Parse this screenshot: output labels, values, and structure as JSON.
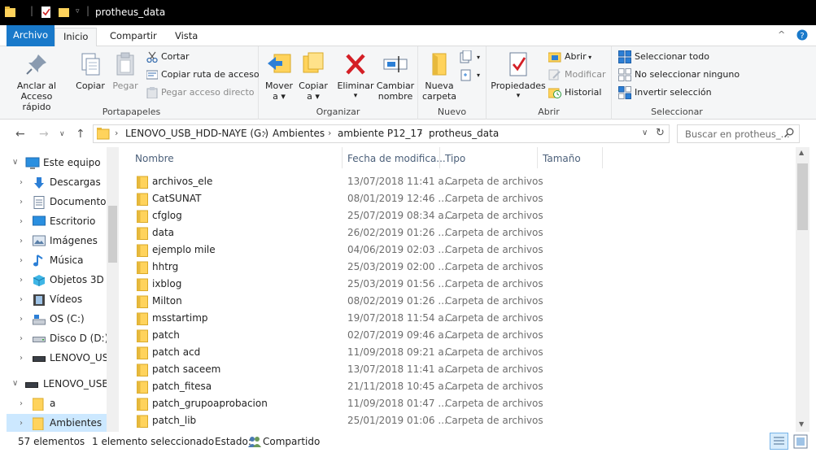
{
  "window": {
    "title": "protheus_data"
  },
  "ribbon_tabs": [
    "Archivo",
    "Inicio",
    "Compartir",
    "Vista"
  ],
  "ribbon": {
    "portapapeles": {
      "label": "Portapapeles",
      "anclar_line1": "Anclar al",
      "anclar_line2": "Acceso rápido",
      "copiar": "Copiar",
      "pegar": "Pegar",
      "cortar": "Cortar",
      "copiar_ruta": "Copiar ruta de acceso",
      "pegar_acceso": "Pegar acceso directo"
    },
    "organizar": {
      "label": "Organizar",
      "mover_line1": "Mover",
      "mover_line2": "a",
      "copiar_line1": "Copiar",
      "copiar_line2": "a",
      "eliminar": "Eliminar",
      "cambiar_line1": "Cambiar",
      "cambiar_line2": "nombre"
    },
    "nuevo": {
      "label": "Nuevo",
      "nueva_line1": "Nueva",
      "nueva_line2": "carpeta"
    },
    "abrir": {
      "label": "Abrir",
      "propiedades": "Propiedades",
      "abrir": "Abrir",
      "modificar": "Modificar",
      "historial": "Historial"
    },
    "seleccionar": {
      "label": "Seleccionar",
      "todo": "Seleccionar todo",
      "ninguno": "No seleccionar ninguno",
      "invertir": "Invertir selección"
    }
  },
  "address": {
    "crumbs": [
      "LENOVO_USB_HDD-NAYE (G:)",
      "Ambientes",
      "ambiente P12_17",
      "protheus_data"
    ],
    "search_placeholder": "Buscar en protheus_..."
  },
  "nav_items": [
    {
      "label": "Este equipo",
      "icon": "computer-icon"
    },
    {
      "label": "Descargas",
      "icon": "download-icon"
    },
    {
      "label": "Documentos",
      "icon": "document-icon"
    },
    {
      "label": "Escritorio",
      "icon": "desktop-icon"
    },
    {
      "label": "Imágenes",
      "icon": "image-icon"
    },
    {
      "label": "Música",
      "icon": "music-icon"
    },
    {
      "label": "Objetos 3D",
      "icon": "cube-icon"
    },
    {
      "label": "Vídeos",
      "icon": "video-icon"
    },
    {
      "label": "OS (C:)",
      "icon": "os-drive-icon"
    },
    {
      "label": "Disco D (D:)",
      "icon": "drive-icon"
    },
    {
      "label": "LENOVO_USB_HDD-NAYE (G:)",
      "icon": "usb-drive-icon"
    },
    {
      "label": "LENOVO_USB_HDD-NAYE (G:)",
      "icon": "usb-drive-icon"
    },
    {
      "label": "a",
      "icon": "folder-icon"
    },
    {
      "label": "Ambientes",
      "icon": "folder-icon"
    }
  ],
  "columns": [
    "Nombre",
    "Fecha de modifica...",
    "Tipo",
    "Tamaño"
  ],
  "files": [
    {
      "name": "archivos_ele",
      "date": "13/07/2018 11:41 a...",
      "type": "Carpeta de archivos"
    },
    {
      "name": "CatSUNAT",
      "date": "08/01/2019 12:46 ...",
      "type": "Carpeta de archivos"
    },
    {
      "name": "cfglog",
      "date": "25/07/2019 08:34 a...",
      "type": "Carpeta de archivos"
    },
    {
      "name": "data",
      "date": "26/02/2019 01:26 ...",
      "type": "Carpeta de archivos"
    },
    {
      "name": "ejemplo mile",
      "date": "04/06/2019 02:03 ...",
      "type": "Carpeta de archivos"
    },
    {
      "name": "hhtrg",
      "date": "25/03/2019 02:00 ...",
      "type": "Carpeta de archivos"
    },
    {
      "name": "ixblog",
      "date": "25/03/2019 01:56 ...",
      "type": "Carpeta de archivos"
    },
    {
      "name": "Milton",
      "date": "08/02/2019 01:26 ...",
      "type": "Carpeta de archivos"
    },
    {
      "name": "msstartimp",
      "date": "19/07/2018 11:54 a...",
      "type": "Carpeta de archivos"
    },
    {
      "name": "patch",
      "date": "02/07/2019 09:46 a...",
      "type": "Carpeta de archivos"
    },
    {
      "name": "patch acd",
      "date": "11/09/2018 09:21 a...",
      "type": "Carpeta de archivos"
    },
    {
      "name": "patch saceem",
      "date": "13/07/2018 11:41 a...",
      "type": "Carpeta de archivos"
    },
    {
      "name": "patch_fitesa",
      "date": "21/11/2018 10:45 a...",
      "type": "Carpeta de archivos"
    },
    {
      "name": "patch_grupoaprobacion",
      "date": "11/09/2018 01:47 ...",
      "type": "Carpeta de archivos"
    },
    {
      "name": "patch_lib",
      "date": "25/01/2019 01:06 ...",
      "type": "Carpeta de archivos"
    }
  ],
  "status": {
    "count": "57 elementos",
    "selected": "1 elemento seleccionado",
    "estado_label": "Estado:",
    "estado_value": "Compartido"
  },
  "colors": {
    "accent": "#1979ca",
    "folder": "#ffd35c",
    "selection": "#cce8ff"
  }
}
